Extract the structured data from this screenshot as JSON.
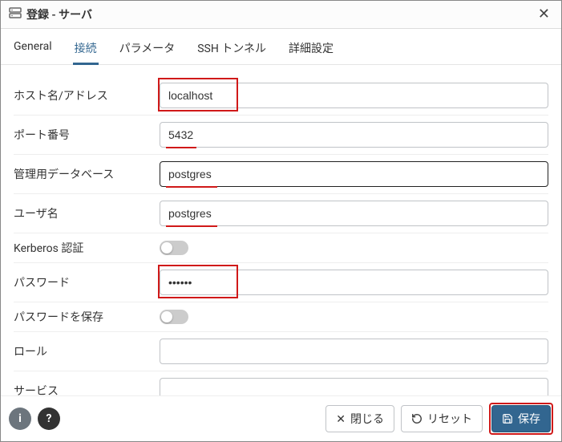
{
  "title": "登録 - サーバ",
  "tabs": {
    "general": "General",
    "connection": "接続",
    "parameters": "パラメータ",
    "ssh": "SSH トンネル",
    "advanced": "詳細設定"
  },
  "fields": {
    "host": {
      "label": "ホスト名/アドレス",
      "value": "localhost"
    },
    "port": {
      "label": "ポート番号",
      "value": "5432"
    },
    "maintdb": {
      "label": "管理用データベース",
      "value": "postgres"
    },
    "user": {
      "label": "ユーザ名",
      "value": "postgres"
    },
    "kerberos": {
      "label": "Kerberos 認証",
      "on": false
    },
    "password": {
      "label": "パスワード",
      "value": "••••••"
    },
    "savepwd": {
      "label": "パスワードを保存",
      "on": false
    },
    "role": {
      "label": "ロール",
      "value": ""
    },
    "service": {
      "label": "サービス",
      "value": ""
    }
  },
  "footer": {
    "close": "閉じる",
    "reset": "リセット",
    "save": "保存"
  }
}
